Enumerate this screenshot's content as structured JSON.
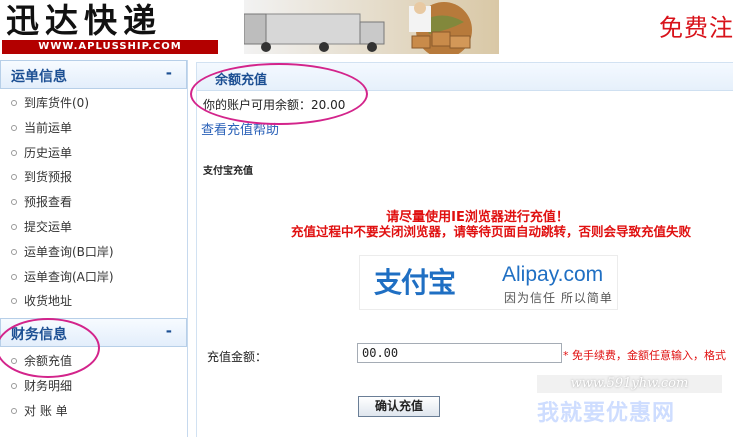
{
  "header": {
    "logo_cn": "迅达快递",
    "logo_en": "WWW.APLUSSHIP.COM",
    "slogan": "免费注"
  },
  "sidebar": {
    "waybill": {
      "title": "运单信息",
      "toggle": "-",
      "items": [
        {
          "label": "到库货件(0)"
        },
        {
          "label": "当前运单"
        },
        {
          "label": "历史运单"
        },
        {
          "label": "到货预报"
        },
        {
          "label": "预报查看"
        },
        {
          "label": "提交运单"
        },
        {
          "label": "运单查询(B口岸)"
        },
        {
          "label": "运单查询(A口岸)"
        },
        {
          "label": "收货地址"
        }
      ]
    },
    "finance": {
      "title": "财务信息",
      "toggle": "-",
      "items": [
        {
          "label": "余额充值"
        },
        {
          "label": "财务明细"
        },
        {
          "label": "对 账 单"
        }
      ]
    }
  },
  "main": {
    "title": "余额充值",
    "balance_text": "你的账户可用余额：20.00",
    "help_link": "查看充值帮助",
    "alipay_section_label": "支付宝充值",
    "notice_1": "请尽量使用IE浏览器进行充值！",
    "notice_2": "充值过程中不要关闭浏览器，请等待页面自动跳转，否则会导致充值失败",
    "alipay_logo": {
      "cn": "支付宝",
      "en": "Alipay.com",
      "slogan": "因为信任 所以简单"
    },
    "amount_label": "充值金额：",
    "amount_value": "00.00",
    "amount_tip": "* 免手续费，金额任意输入，格式",
    "confirm_button": "确认充值"
  },
  "watermark": {
    "url": "www.591yhw.com",
    "site": "我就要优惠网"
  },
  "colors": {
    "accent_blue": "#1c4f93",
    "alert_red": "#e01010",
    "annotation_pink": "#d3248b"
  }
}
